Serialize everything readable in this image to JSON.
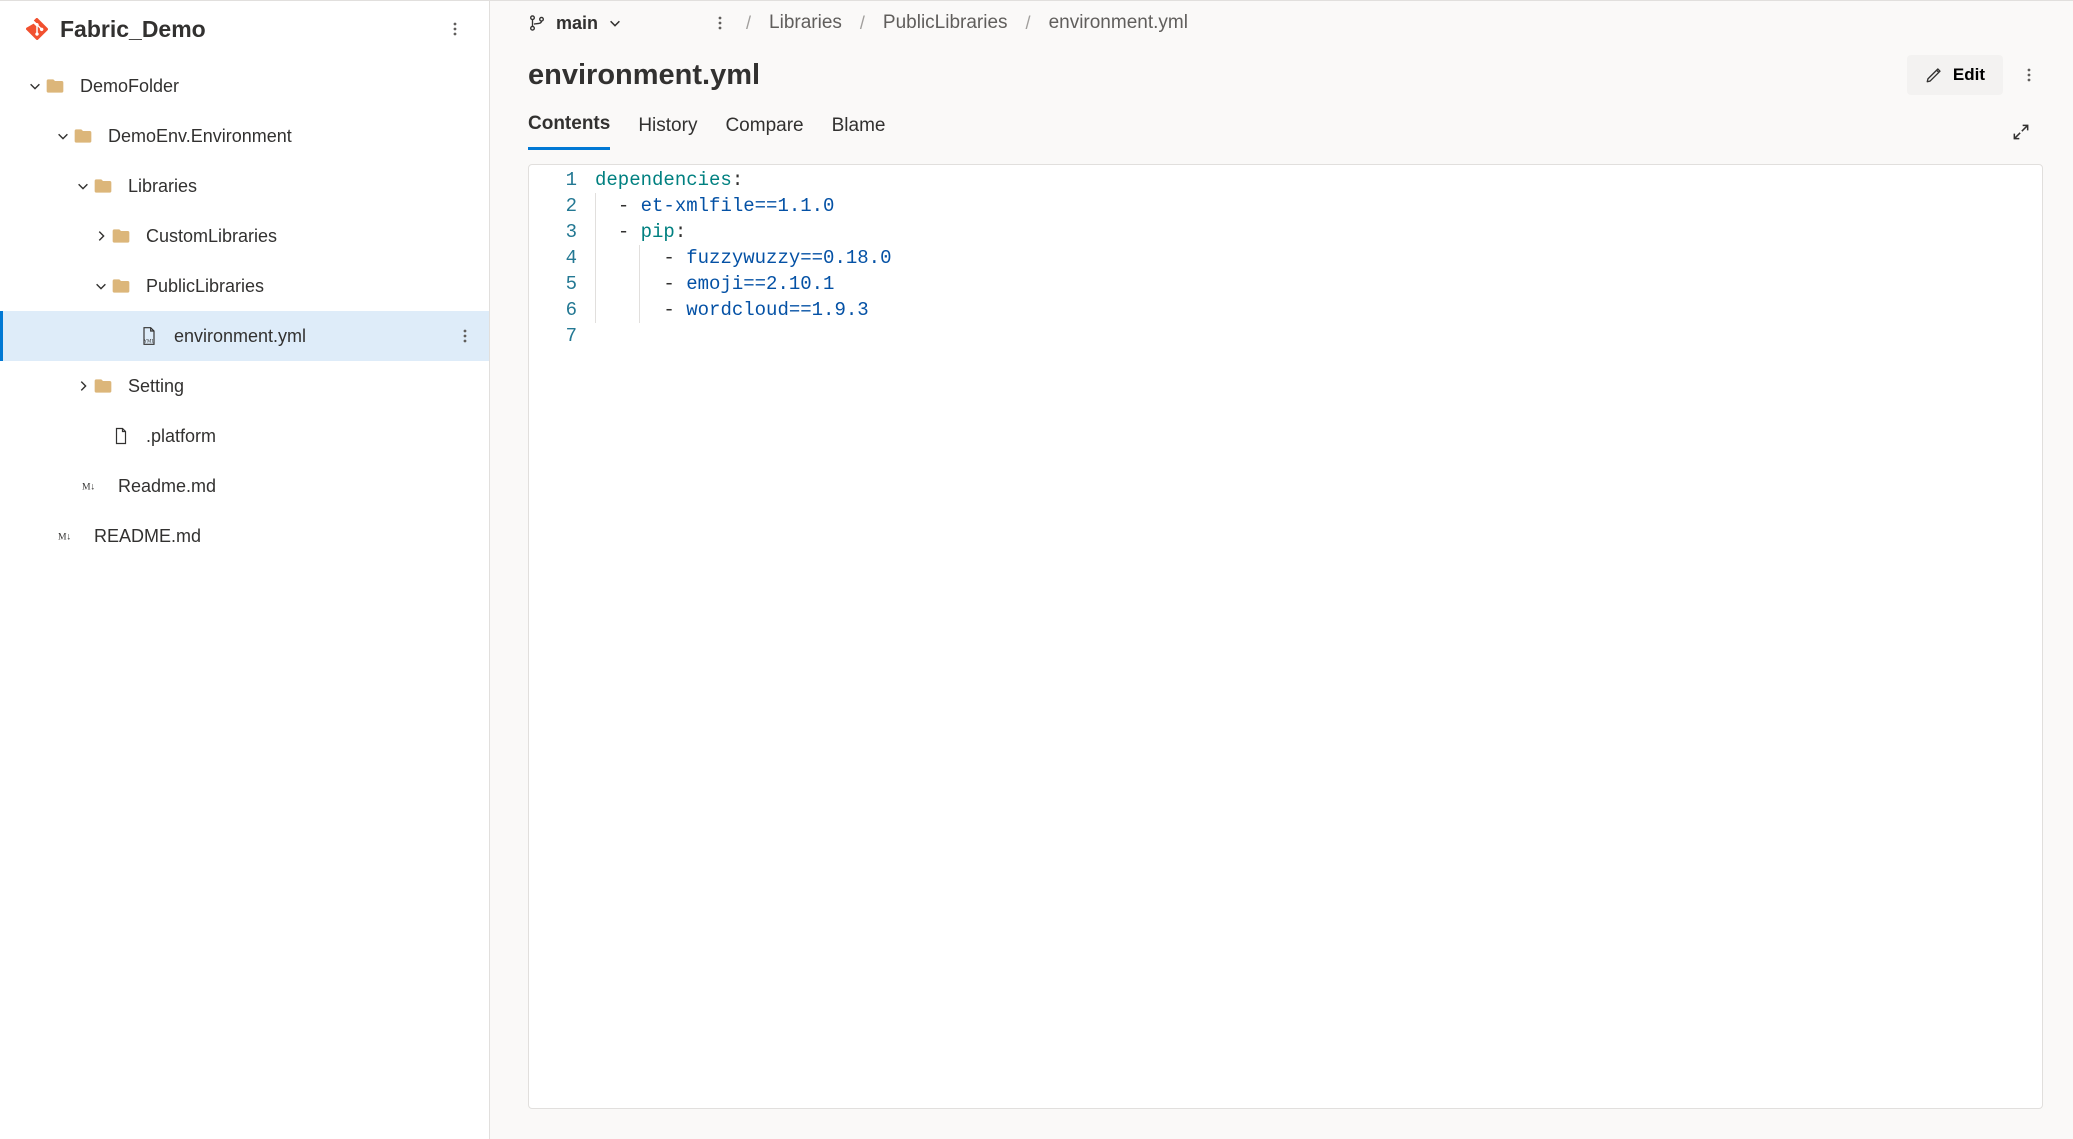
{
  "repo": {
    "name": "Fabric_Demo"
  },
  "tree": {
    "demoFolder": "DemoFolder",
    "demoEnv": "DemoEnv.Environment",
    "libraries": "Libraries",
    "customLibraries": "CustomLibraries",
    "publicLibraries": "PublicLibraries",
    "environmentYml": "environment.yml",
    "setting": "Setting",
    "platform": ".platform",
    "readmeLower": "Readme.md",
    "readmeUpper": "README.md"
  },
  "branch": {
    "name": "main"
  },
  "breadcrumb": {
    "libraries": "Libraries",
    "publicLibraries": "PublicLibraries",
    "file": "environment.yml"
  },
  "file": {
    "title": "environment.yml"
  },
  "actions": {
    "edit": "Edit"
  },
  "tabs": {
    "contents": "Contents",
    "history": "History",
    "compare": "Compare",
    "blame": "Blame"
  },
  "code": {
    "lineNums": [
      "1",
      "2",
      "3",
      "4",
      "5",
      "6",
      "7"
    ],
    "l1_key": "dependencies",
    "l2_pkg": "et-xmlfile==1.1.0",
    "l3_key": "pip",
    "l4_pkg": "fuzzywuzzy==0.18.0",
    "l5_pkg": "emoji==2.10.1",
    "l6_pkg": "wordcloud==1.9.3"
  }
}
